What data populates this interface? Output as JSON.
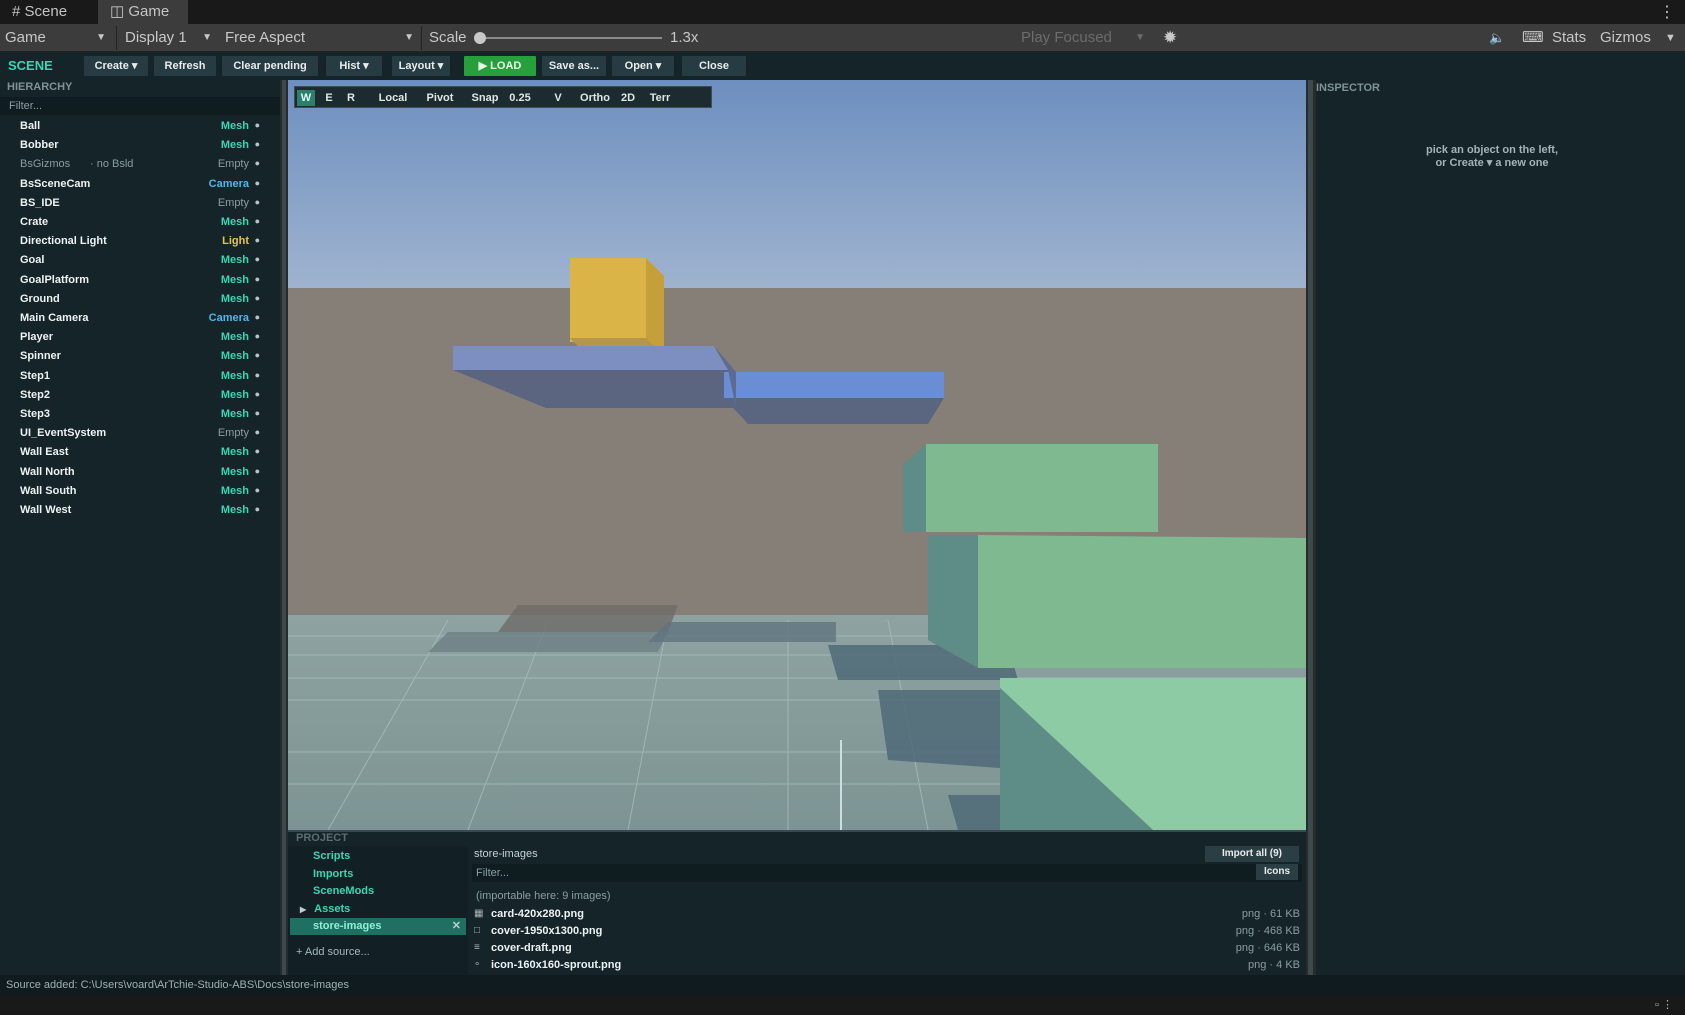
{
  "tabs": [
    {
      "label": "Scene",
      "icon": "grid-icon"
    },
    {
      "label": "Game",
      "icon": "gamepad-icon"
    }
  ],
  "game_toolbar": {
    "view": "Game",
    "display": "Display 1",
    "aspect": "Free Aspect",
    "scale_label": "Scale",
    "scale_value": "1.3x",
    "play_focused": "Play Focused",
    "stats": "Stats",
    "gizmos": "Gizmos"
  },
  "app_toolbar": {
    "title": "SCENE",
    "buttons": [
      "Create ▾",
      "Refresh",
      "Clear pending",
      "Hist ▾",
      "Layout ▾",
      "▶ LOAD",
      "Save as...",
      "Open ▾",
      "Close"
    ]
  },
  "hierarchy": {
    "title": "HIERARCHY",
    "filter_placeholder": "Filter...",
    "items": [
      {
        "name": "Ball",
        "type": "Mesh"
      },
      {
        "name": "Bobber",
        "type": "Mesh"
      },
      {
        "name": "BsGizmos",
        "note": "· no Bsld",
        "type": "Empty"
      },
      {
        "name": "BsSceneCam",
        "type": "Camera"
      },
      {
        "name": "BS_IDE",
        "type": "Empty"
      },
      {
        "name": "Crate",
        "type": "Mesh"
      },
      {
        "name": "Directional Light",
        "type": "Light"
      },
      {
        "name": "Goal",
        "type": "Mesh"
      },
      {
        "name": "GoalPlatform",
        "type": "Mesh"
      },
      {
        "name": "Ground",
        "type": "Mesh"
      },
      {
        "name": "Main Camera",
        "type": "Camera"
      },
      {
        "name": "Player",
        "type": "Mesh"
      },
      {
        "name": "Spinner",
        "type": "Mesh"
      },
      {
        "name": "Step1",
        "type": "Mesh"
      },
      {
        "name": "Step2",
        "type": "Mesh"
      },
      {
        "name": "Step3",
        "type": "Mesh"
      },
      {
        "name": "UI_EventSystem",
        "type": "Empty"
      },
      {
        "name": "Wall East",
        "type": "Mesh"
      },
      {
        "name": "Wall North",
        "type": "Mesh"
      },
      {
        "name": "Wall South",
        "type": "Mesh"
      },
      {
        "name": "Wall West",
        "type": "Mesh"
      }
    ],
    "type_colors": {
      "Mesh": "#38d6b4",
      "Empty": "#8a9ea2",
      "Camera": "#4fb6e8",
      "Light": "#e8c44a"
    }
  },
  "viewport_toolbar": {
    "buttons": [
      "W",
      "E",
      "R",
      "Local",
      "Pivot",
      "Snap",
      "0.25",
      "V",
      "Ortho",
      "2D",
      "Terr"
    ],
    "active": "W"
  },
  "inspector": {
    "title": "INSPECTOR",
    "hint_line1": "pick an object on the left,",
    "hint_line2": "or Create ▾ a new one"
  },
  "project": {
    "title": "PROJECT",
    "sources": [
      "Scripts",
      "Imports",
      "SceneMods",
      "Assets",
      "store-images"
    ],
    "selected_source": "store-images",
    "add_source": "+ Add source...",
    "current_path": "store-images",
    "import_all": "Import all (9)",
    "filter_placeholder": "Filter...",
    "view_mode": "Icons",
    "note": "(importable here: 9 images)",
    "files": [
      {
        "name": "card-420x280.png",
        "meta": "png · 61 KB"
      },
      {
        "name": "cover-1950x1300.png",
        "meta": "png · 468 KB"
      },
      {
        "name": "cover-draft.png",
        "meta": "png · 646 KB"
      },
      {
        "name": "icon-160x160-sprout.png",
        "meta": "png · 4 KB"
      }
    ]
  },
  "status": "Source added: C:\\Users\\voard\\ArTchie-Studio-ABS\\Docs\\store-images",
  "colors": {
    "accent": "#38d6b4",
    "panel_bg": "#152429",
    "load_green": "#27a03c"
  }
}
